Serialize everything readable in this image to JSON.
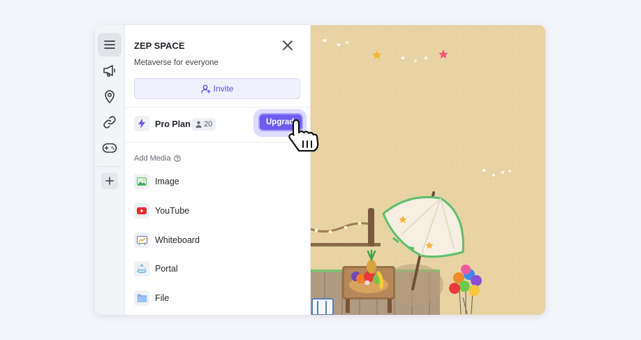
{
  "space": {
    "title": "ZEP SPACE",
    "subtitle": "Metaverse for everyone",
    "invite_label": "Invite"
  },
  "rail": {
    "items": [
      {
        "icon": "menu-icon"
      },
      {
        "icon": "megaphone-icon"
      },
      {
        "icon": "location-pin-icon"
      },
      {
        "icon": "link-icon"
      },
      {
        "icon": "gamepad-icon"
      }
    ],
    "add_icon": "plus-icon"
  },
  "plan": {
    "label": "Pro Plan",
    "user_count": "20",
    "upgrade_label": "Upgrade"
  },
  "media": {
    "section_label": "Add Media",
    "items": [
      {
        "label": "Image",
        "icon": "image-icon"
      },
      {
        "label": "YouTube",
        "icon": "youtube-icon"
      },
      {
        "label": "Whiteboard",
        "icon": "whiteboard-icon"
      },
      {
        "label": "Portal",
        "icon": "portal-icon"
      },
      {
        "label": "File",
        "icon": "folder-icon"
      }
    ]
  },
  "colors": {
    "accent": "#6e5cf0",
    "invite_bg": "#f1f0ff",
    "sand": "#e8d3a4"
  }
}
